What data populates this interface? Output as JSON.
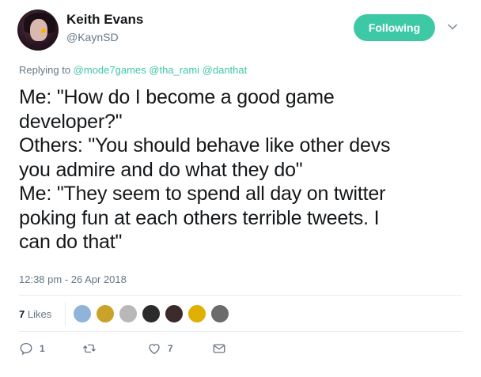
{
  "header": {
    "display_name": "Keith Evans",
    "handle": "@KaynSD",
    "follow_button": "Following"
  },
  "reply_context": {
    "prefix": "Replying to",
    "mentions": [
      "@mode7games",
      "@tha_rami",
      "@danthat"
    ]
  },
  "tweet": {
    "lines": [
      "Me: \"How do I become a good game",
      "developer?\"",
      "Others: \"You should behave like other devs",
      "you admire and do what they do\"",
      "Me: \"They seem to spend all day on twitter",
      "poking fun at each others terrible tweets. I",
      "can do that\""
    ],
    "timestamp": "12:38 pm - 26 Apr 2018"
  },
  "stats": {
    "likes_count": "7",
    "likes_label": "Likes",
    "liker_colors": [
      "#8fb3d9",
      "#c9a227",
      "#b8b8b8",
      "#2b2b2b",
      "#3a2a2a",
      "#e0b000",
      "#6b6b6b"
    ]
  },
  "actions": {
    "reply_count": "1",
    "retweet_count": "",
    "like_count": "7"
  },
  "colors": {
    "accent": "#3ec9a6",
    "muted": "#657786",
    "text": "#14171a"
  }
}
